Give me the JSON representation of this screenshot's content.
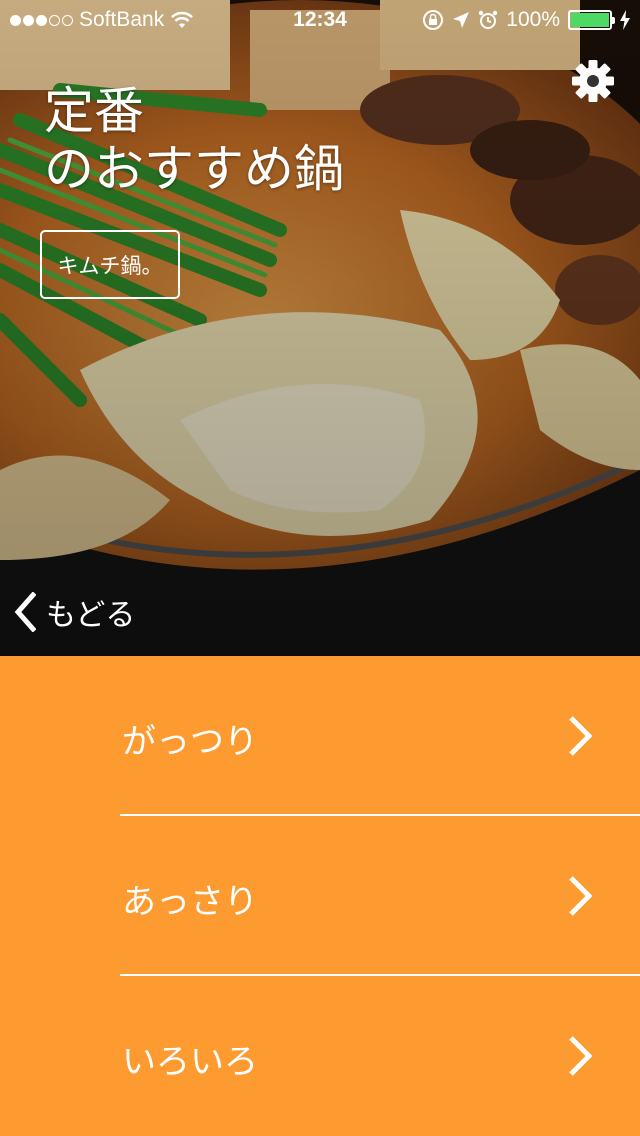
{
  "status_bar": {
    "carrier": "SoftBank",
    "time": "12:34",
    "battery": "100%",
    "battery_level": 1.0,
    "signal_bars": 3,
    "signal_total": 5
  },
  "header": {
    "title_line1": "定番",
    "title_line2": "のおすすめ鍋",
    "tag": "キムチ鍋。",
    "back": "もどる"
  },
  "menu": {
    "items": [
      {
        "label": "がっつり"
      },
      {
        "label": "あっさり"
      },
      {
        "label": "いろいろ"
      }
    ]
  },
  "colors": {
    "menu_bg": "#fd9a30",
    "battery_fill": "#4cd964"
  },
  "icons": [
    "wifi-icon",
    "lock-rotation-icon",
    "location-arrow-icon",
    "alarm-icon",
    "battery-icon",
    "charging-icon",
    "gear-icon",
    "chevron-left-icon",
    "chevron-right-icon"
  ]
}
